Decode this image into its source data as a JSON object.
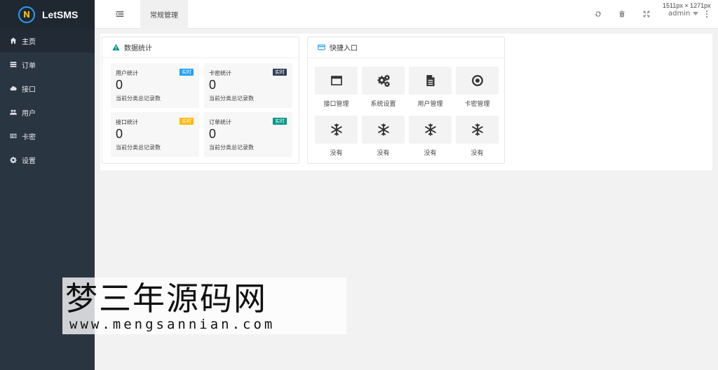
{
  "brand": {
    "logo_letter": "N",
    "name": "LetSMS"
  },
  "sidebar": {
    "items": [
      {
        "label": "主页",
        "icon": "home-icon",
        "active": true
      },
      {
        "label": "订单",
        "icon": "list-icon",
        "active": false
      },
      {
        "label": "接口",
        "icon": "cloud-icon",
        "active": false
      },
      {
        "label": "用户",
        "icon": "users-icon",
        "active": false
      },
      {
        "label": "卡密",
        "icon": "id-card-icon",
        "active": false
      },
      {
        "label": "设置",
        "icon": "gear-icon",
        "active": false
      }
    ]
  },
  "header": {
    "tab_label": "常规管理",
    "user_name": "admin",
    "dimension_text": "1511px × 1271px"
  },
  "stats_panel": {
    "title": "数据统计",
    "cards": [
      {
        "title": "用户统计",
        "badge": "实时",
        "badge_color": "#1e9fff",
        "value": "0",
        "desc": "当前分类总记录数"
      },
      {
        "title": "卡密统计",
        "badge": "实时",
        "badge_color": "#2f4056",
        "value": "0",
        "desc": "当前分类总记录数"
      },
      {
        "title": "接口统计",
        "badge": "实时",
        "badge_color": "#ffb800",
        "value": "0",
        "desc": "当前分类总记录数"
      },
      {
        "title": "订单统计",
        "badge": "实时",
        "badge_color": "#009688",
        "value": "0",
        "desc": "当前分类总记录数"
      }
    ]
  },
  "quick_panel": {
    "title": "快捷入口",
    "items": [
      {
        "label": "接口管理",
        "icon": "window-icon"
      },
      {
        "label": "系统设置",
        "icon": "gears-icon"
      },
      {
        "label": "用户管理",
        "icon": "document-icon"
      },
      {
        "label": "卡密管理",
        "icon": "target-icon"
      },
      {
        "label": "没有",
        "icon": "snowflake-icon"
      },
      {
        "label": "没有",
        "icon": "snowflake-icon"
      },
      {
        "label": "没有",
        "icon": "snowflake-icon"
      },
      {
        "label": "没有",
        "icon": "snowflake-icon"
      }
    ]
  },
  "watermark": {
    "title": "梦三年源码网",
    "url": "www.mengsannian.com"
  },
  "colors": {
    "sidebar_bg": "#2a3542",
    "brand_bg": "#1f2730",
    "accent_blue": "#1e9fff",
    "warning_icon": "#009688"
  }
}
